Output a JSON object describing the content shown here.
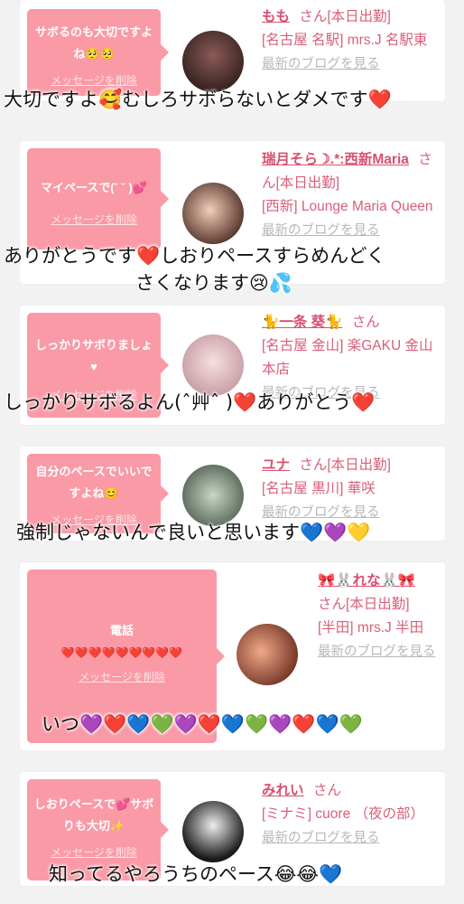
{
  "colors": {
    "bubble": "#f99aa6",
    "name": "#d9506f",
    "text": "#d9607a",
    "blog": "#b8b8b8"
  },
  "cards": [
    {
      "bubble_text": "サボるのも大切ですよね🥺🥺",
      "delete_label": "メッセージを削除",
      "name": "もも",
      "san": "さん[本日出勤]",
      "shop": "[名古屋 名駅] mrs.J 名駅東",
      "blog": "最新のブログを見る"
    },
    {
      "bubble_text": "マイペースで(˘ ˘ )💕",
      "delete_label": "メッセージを削除",
      "name": "瑞月そら☽.*:西新Maria",
      "san": "さん[本日出勤]",
      "shop": "[西新] Lounge Maria Queen",
      "blog": "最新のブログを見る"
    },
    {
      "bubble_text": "しっかりサボりましょ♥",
      "delete_label": "メッセージを削除",
      "name": "🐈一条 葵🐈",
      "san": "さん",
      "shop": "[名古屋 金山] 楽GAKU 金山本店",
      "blog": "最新のブログを見る"
    },
    {
      "bubble_text": "自分のペースでいいですよね😊",
      "delete_label": "メッセージを削除",
      "name": "ユナ",
      "san": "さん[本日出勤]",
      "shop": "[名古屋 黒川] 華咲",
      "blog": "最新のブログを見る"
    },
    {
      "bubble_title": "電話",
      "bubble_text": "❤️❤️❤️❤️❤️❤️❤️❤️❤️",
      "delete_label": "メッセージを削除",
      "name": "🎀🐰れな🐰🎀",
      "san": "さん[本日出勤]",
      "shop": "[半田] mrs.J 半田",
      "blog": "最新のブログを見る"
    },
    {
      "bubble_text": "しおりペースで💕サボりも大切✨",
      "delete_label": "メッセージを削除",
      "name": "みれい",
      "san": "さん",
      "shop": "[ミナミ] cuore （夜の部）",
      "blog": "最新のブログを見る"
    }
  ],
  "overlays": [
    "大切ですよ🥰むしろサボらないとダメです❤️",
    "ありがとうです❤️しおりペースすらめんどく",
    "さくなります😢💦",
    "しっかりサボるよん(ˆ艸ˆ )❤️ありがとう❤️",
    "強制じゃないんで良いと思います💙💜💛",
    "いつ💜❤️💙💚💜❤️💙💚💜❤️💙💚",
    "知ってるやろうちのペース😂😂💙"
  ]
}
